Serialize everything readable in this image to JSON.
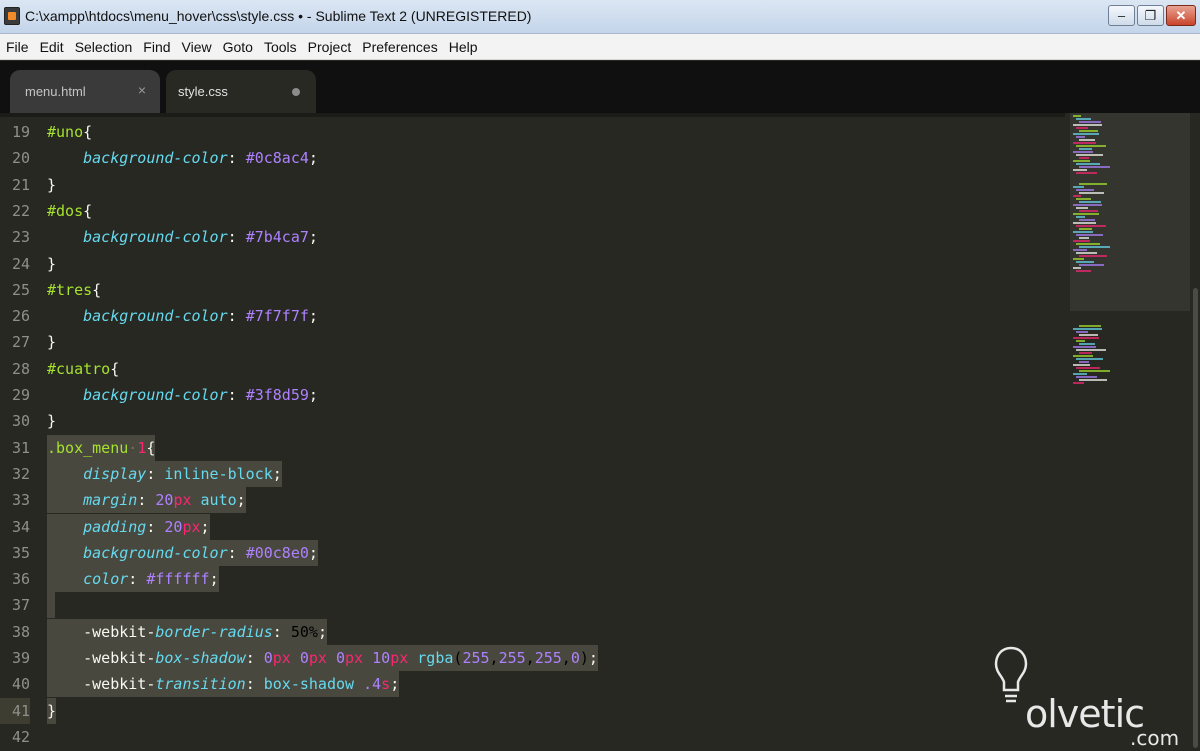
{
  "window": {
    "title": "C:\\xampp\\htdocs\\menu_hover\\css\\style.css • - Sublime Text 2 (UNREGISTERED)",
    "minimize": "–",
    "maximize": "❐",
    "close": "✕"
  },
  "menu": [
    "File",
    "Edit",
    "Selection",
    "Find",
    "View",
    "Goto",
    "Tools",
    "Project",
    "Preferences",
    "Help"
  ],
  "tabs": [
    {
      "label": "menu.html",
      "close": "×"
    },
    {
      "label": "style.css"
    }
  ],
  "editor": {
    "language": "CSS",
    "lines": [
      {
        "n": "19",
        "code": "#uno{"
      },
      {
        "n": "20",
        "code": "    background-color: #0c8ac4;"
      },
      {
        "n": "21",
        "code": "}"
      },
      {
        "n": "22",
        "code": "#dos{"
      },
      {
        "n": "23",
        "code": "    background-color: #7b4ca7;"
      },
      {
        "n": "24",
        "code": "}"
      },
      {
        "n": "25",
        "code": "#tres{"
      },
      {
        "n": "26",
        "code": "    background-color: #7f7f7f;"
      },
      {
        "n": "27",
        "code": "}"
      },
      {
        "n": "28",
        "code": "#cuatro{"
      },
      {
        "n": "29",
        "code": "    background-color: #3f8d59;"
      },
      {
        "n": "30",
        "code": "}"
      },
      {
        "n": "31",
        "code": ".box_menu 1{"
      },
      {
        "n": "32",
        "code": "    display: inline-block;"
      },
      {
        "n": "33",
        "code": "    margin: 20px auto;"
      },
      {
        "n": "34",
        "code": "    padding: 20px;"
      },
      {
        "n": "35",
        "code": "    background-color: #00c8e0;"
      },
      {
        "n": "36",
        "code": "    color: #ffffff;"
      },
      {
        "n": "37",
        "code": ""
      },
      {
        "n": "38",
        "code": "    -webkit-border-radius: 50%;"
      },
      {
        "n": "39",
        "code": "    -webkit-box-shadow: 0px 0px 0px 10px rgba(255,255,255,0);"
      },
      {
        "n": "40",
        "code": "    -webkit-transition: box-shadow .4s;"
      },
      {
        "n": "41",
        "code": "}"
      },
      {
        "n": "42",
        "code": ""
      }
    ]
  },
  "watermark": {
    "brand": "olvetic",
    "suffix": ".com"
  },
  "colors": {
    "background": "#272822",
    "selection": "#49483e",
    "selector": "#a6e22e",
    "property": "#66d9ef",
    "value": "#ae81ff",
    "unit": "#f92672",
    "text": "#f8f8f2"
  }
}
